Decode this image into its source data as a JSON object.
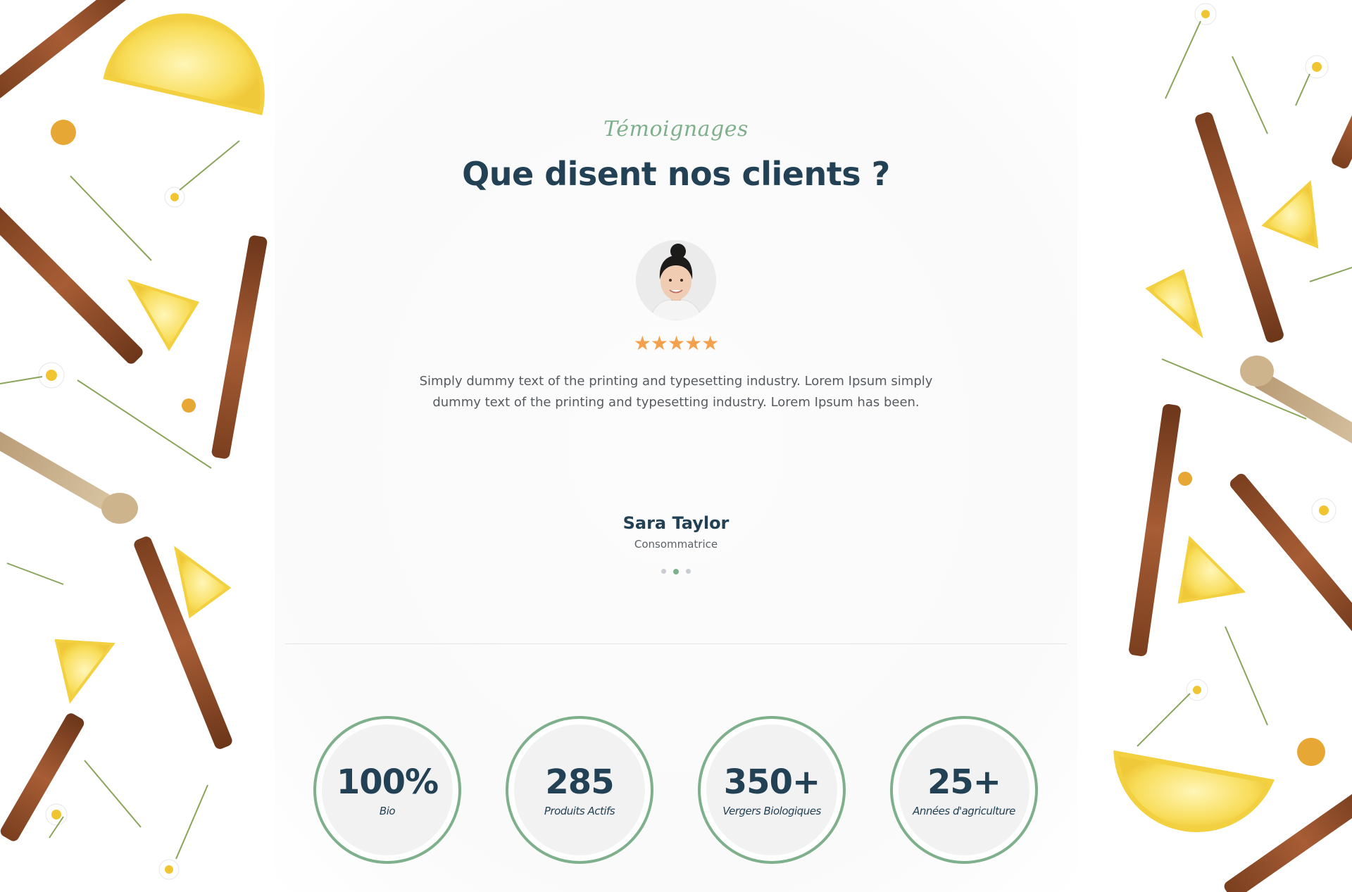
{
  "testimonials": {
    "kicker": "Témoignages",
    "title": "Que disent nos clients ?",
    "rating_stars": "★★★★★",
    "rating": 5,
    "quote": "Simply dummy text of the printing and typesetting industry. Lorem Ipsum simply dummy text of the printing and typesetting industry. Lorem Ipsum has been.",
    "author_name": "Sara Taylor",
    "author_role": "Consommatrice",
    "slides_count": 3,
    "active_slide": 2
  },
  "stats": [
    {
      "value": "100%",
      "label": "Bio"
    },
    {
      "value": "285",
      "label": "Produits Actifs"
    },
    {
      "value": "350+",
      "label": "Vergers Biologiques"
    },
    {
      "value": "25+",
      "label": "Années d'agriculture"
    }
  ],
  "colors": {
    "accent": "#7fb08c",
    "heading": "#234154",
    "body_text": "#555b60",
    "stars": "#f4a14e",
    "stat_fill": "#f2f2f2",
    "divider": "#e6e6e6"
  },
  "icons": {
    "rating": "star-icon",
    "decorations": [
      "cinnamon-stick",
      "lemon-slice",
      "chamomile-flower",
      "wooden-pestle",
      "rosehip-berry"
    ]
  }
}
